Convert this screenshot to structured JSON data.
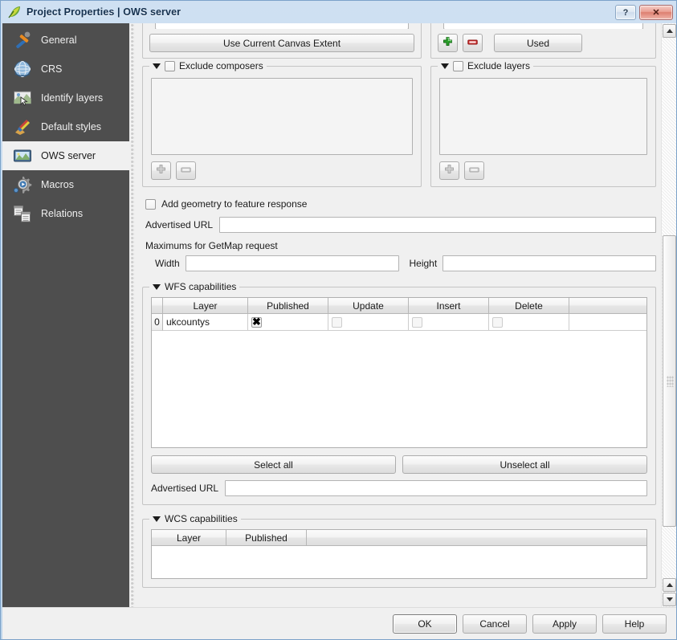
{
  "window": {
    "title": "Project Properties | OWS server",
    "icon": "qgis-leaf-icon",
    "help_button": "?",
    "close_button": "✕"
  },
  "sidebar": {
    "items": [
      {
        "label": "General",
        "icon": "hammer-wrench-icon",
        "selected": false
      },
      {
        "label": "CRS",
        "icon": "globe-icon",
        "selected": false
      },
      {
        "label": "Identify layers",
        "icon": "map-cursor-icon",
        "selected": false
      },
      {
        "label": "Default styles",
        "icon": "paintbrush-icon",
        "selected": false
      },
      {
        "label": "OWS server",
        "icon": "ows-server-icon",
        "selected": true
      },
      {
        "label": "Macros",
        "icon": "gear-play-icon",
        "selected": false
      },
      {
        "label": "Relations",
        "icon": "tables-link-icon",
        "selected": false
      }
    ]
  },
  "content": {
    "extent_group": {
      "use_current_canvas_extent_label": "Use Current Canvas Extent"
    },
    "crs_group": {
      "add_icon": "plus-green-icon",
      "remove_icon": "minus-red-icon",
      "used_label": "Used"
    },
    "exclude_composers": {
      "title": "Exclude composers",
      "checked": false,
      "items": [],
      "add_icon": "plus-gray-icon",
      "remove_icon": "minus-gray-icon"
    },
    "exclude_layers": {
      "title": "Exclude layers",
      "checked": false,
      "items": [],
      "add_icon": "plus-gray-icon",
      "remove_icon": "minus-gray-icon"
    },
    "add_geometry": {
      "label": "Add geometry to feature response",
      "checked": false
    },
    "advertised_url_top": {
      "label": "Advertised URL",
      "value": "",
      "placeholder": ""
    },
    "getmap_maximums": {
      "label": "Maximums for GetMap request",
      "width_label": "Width",
      "width_value": "",
      "height_label": "Height",
      "height_value": ""
    },
    "wfs": {
      "title": "WFS capabilities",
      "columns": [
        "",
        "Layer",
        "Published",
        "Update",
        "Insert",
        "Delete"
      ],
      "rows": [
        {
          "index": "0",
          "layer": "ukcountys",
          "published": true,
          "published_enabled": true,
          "update": false,
          "update_enabled": false,
          "insert": false,
          "insert_enabled": false,
          "delete": false,
          "delete_enabled": false
        }
      ],
      "select_all_label": "Select all",
      "unselect_all_label": "Unselect all",
      "advertised_url_label": "Advertised URL",
      "advertised_url_value": ""
    },
    "wcs": {
      "title": "WCS capabilities",
      "columns": [
        "Layer",
        "Published"
      ],
      "rows": []
    }
  },
  "scrollbar": {
    "up_arrow": "▲",
    "down_arrow": "▼"
  },
  "footer": {
    "ok_label": "OK",
    "cancel_label": "Cancel",
    "apply_label": "Apply",
    "help_label": "Help"
  },
  "colors": {
    "titlebar": "#c3d8ec",
    "sidebar_bg": "#4e4e4e",
    "sidebar_selected_bg": "#f0f0f0",
    "dialog_bg": "#f0f0f0",
    "accent_green": "#22a022",
    "accent_red": "#cc2222",
    "close_button": "#dd7f70"
  }
}
